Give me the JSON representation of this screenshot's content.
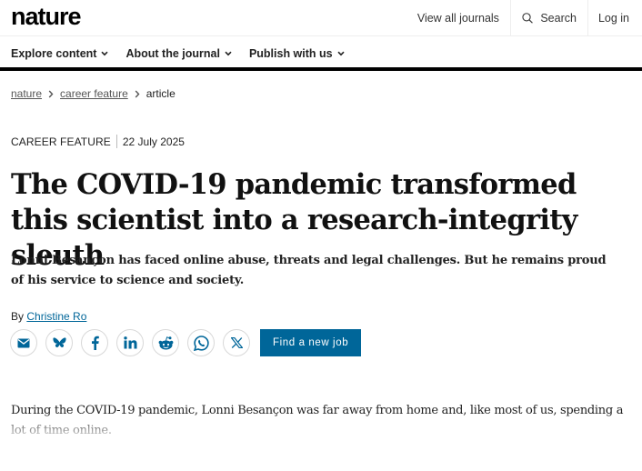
{
  "header": {
    "logo": "nature",
    "links": {
      "journals": "View all journals",
      "search": "Search",
      "login": "Log in"
    }
  },
  "nav": {
    "items": [
      {
        "label": "Explore content"
      },
      {
        "label": "About the journal"
      },
      {
        "label": "Publish with us"
      }
    ]
  },
  "breadcrumb": {
    "items": [
      "nature",
      "career feature"
    ],
    "current": "article"
  },
  "article": {
    "type": "CAREER FEATURE",
    "date": "22 July 2025",
    "title": "The COVID-19 pandemic transformed this scientist into a research-integrity sleuth",
    "standfirst": "Lonni Besançon has faced online abuse, threats and legal challenges. But he remains proud of his service to science and society.",
    "byline_prefix": "By",
    "author": "Christine Ro",
    "body_first": "During the COVID-19 pandemic, Lonni Besançon was far away from home and, like most of us, spending a lot of time online."
  },
  "share": {
    "icons": [
      "email-icon",
      "bluesky-icon",
      "facebook-icon",
      "linkedin-icon",
      "reddit-icon",
      "whatsapp-icon",
      "x-icon"
    ],
    "job_button": "Find a new job"
  },
  "colors": {
    "accent": "#006699",
    "text": "#222222",
    "border": "#d8d8d8"
  }
}
